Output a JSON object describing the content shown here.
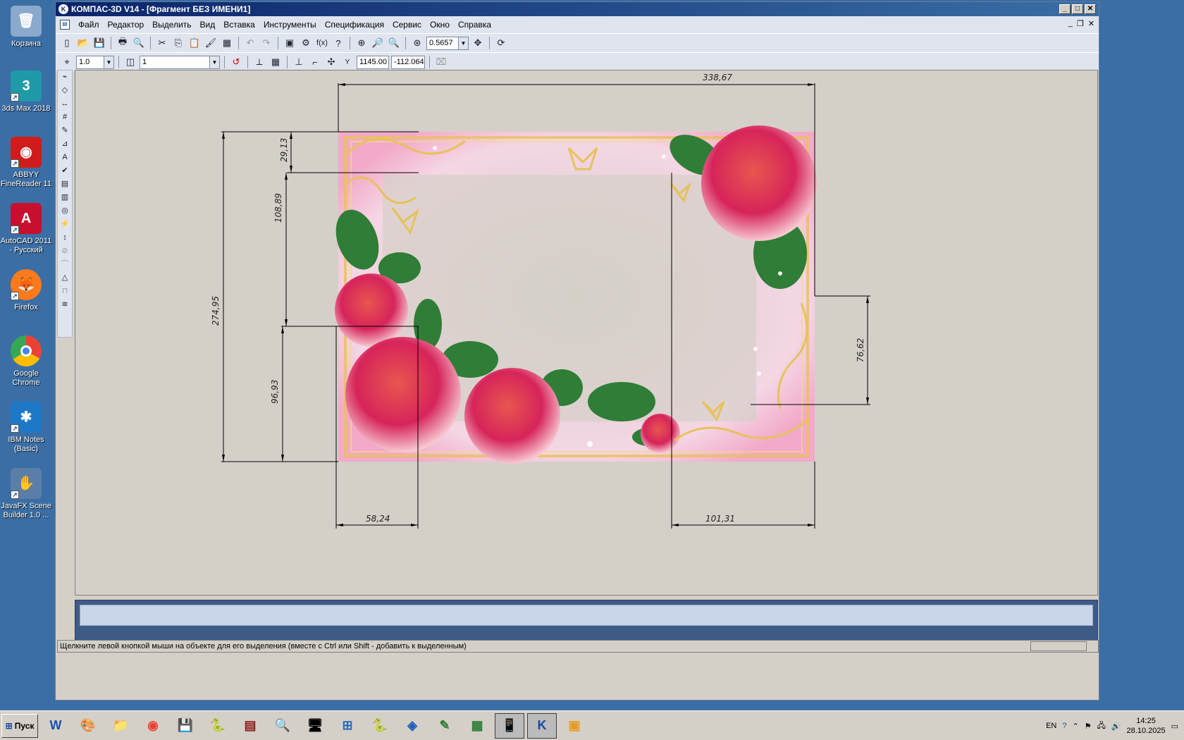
{
  "desktop": {
    "icons": [
      {
        "label": "Корзина",
        "icon": "recycle-bin-icon",
        "color": "#6d8fb7"
      },
      {
        "label": "3ds Max 2018",
        "icon": "3dsmax-icon",
        "color": "#1f9aa7"
      },
      {
        "label": "ABBYY FineReader 11",
        "icon": "abbyy-icon",
        "color": "#d01c1c"
      },
      {
        "label": "AutoCAD 2011 - Русский",
        "icon": "autocad-icon",
        "color": "#c8102e"
      },
      {
        "label": "Firefox",
        "icon": "firefox-icon",
        "color": "#ff7a1a"
      },
      {
        "label": "Google Chrome",
        "icon": "chrome-icon",
        "color": "#34a853"
      },
      {
        "label": "IBM Notes (Basic)",
        "icon": "ibm-notes-icon",
        "color": "#1e78c8"
      },
      {
        "label": "JavaFX Scene Builder 1.0 ...",
        "icon": "javafx-icon",
        "color": "#5a7ea8"
      }
    ]
  },
  "window": {
    "title": "КОМПАС-3D V14 - [Фрагмент БЕЗ ИМЕНИ1]",
    "menu": [
      "Файл",
      "Редактор",
      "Выделить",
      "Вид",
      "Вставка",
      "Инструменты",
      "Спецификация",
      "Сервис",
      "Окно",
      "Справка"
    ],
    "toolbar": {
      "zoom_value": "0.5657",
      "line_step": "1.0",
      "layer": "1",
      "coord_x": "1145.00",
      "coord_y": "-112.064",
      "coord_label": "Y"
    },
    "status_text": "Щелкните левой кнопкой мыши на объекте для его выделения (вместе с Ctrl или Shift - добавить к выделенным)"
  },
  "drawing": {
    "dimensions": {
      "top_width": "338,67",
      "left_total": "274,95",
      "left_top": "29,13",
      "left_mid": "108,89",
      "left_bottom": "96,93",
      "bottom_left": "58,24",
      "bottom_right": "101,31",
      "right_mid": "76,62"
    },
    "image": {
      "frame_color": "#e7c25a",
      "rose_color": "#d6245a",
      "leaf_color": "#2f7d36",
      "bg_color": "#fbe3ef"
    }
  },
  "taskbar": {
    "start_label": "Пуск",
    "lang": "EN",
    "time": "14:25",
    "date": "28.10.2025",
    "apps": [
      "word-icon",
      "paint-icon",
      "explorer-icon",
      "chrome-icon",
      "save-icon",
      "python-icon",
      "winrar-icon",
      "search-icon",
      "pc-icon",
      "network-icon",
      "python-icon",
      "virtualbox-icon",
      "notepad-icon",
      "monitor-icon",
      "device-icon",
      "kompas-icon",
      "app-icon"
    ]
  }
}
